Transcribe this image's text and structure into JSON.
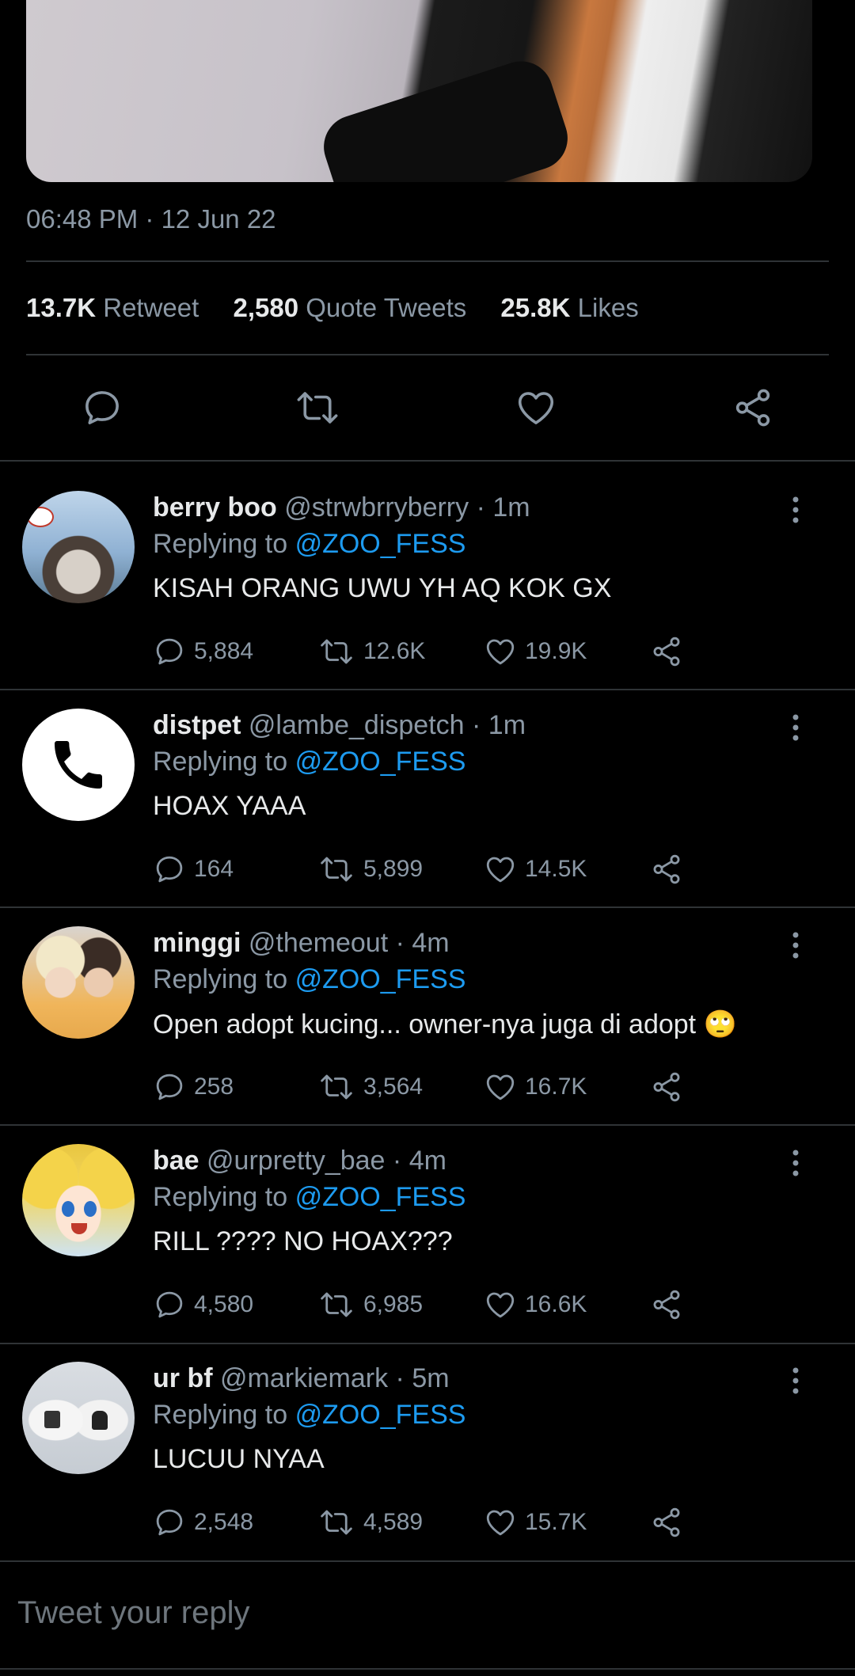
{
  "tweet": {
    "timestamp": "06:48 PM · 12 Jun 22",
    "stats": [
      {
        "count": "13.7K",
        "label": "Retweet"
      },
      {
        "count": "2,580",
        "label": "Quote Tweets"
      },
      {
        "count": "25.8K",
        "label": "Likes"
      }
    ],
    "actions": [
      "reply-icon",
      "retweet-icon",
      "like-icon",
      "share-icon"
    ]
  },
  "replies": [
    {
      "name": "berry boo",
      "handle": "@strwbrryberry",
      "time": "· 1m",
      "replying_label": "Replying to",
      "replying_to": "@ZOO_FESS",
      "text": "KISAH ORANG UWU YH AQ KOK GX",
      "replies": "5,884",
      "retweets": "12.6K",
      "likes": "19.9K"
    },
    {
      "name": "distpet",
      "handle": "@lambe_dispetch",
      "time": "· 1m",
      "replying_label": "Replying to",
      "replying_to": "@ZOO_FESS",
      "text": "HOAX YAAA",
      "replies": "164",
      "retweets": "5,899",
      "likes": "14.5K"
    },
    {
      "name": "minggi",
      "handle": "@themeout",
      "time": "· 4m",
      "replying_label": "Replying to",
      "replying_to": "@ZOO_FESS",
      "text": "Open adopt kucing... owner-nya juga di adopt 🙄",
      "replies": "258",
      "retweets": "3,564",
      "likes": "16.7K"
    },
    {
      "name": "bae",
      "handle": "@urpretty_bae",
      "time": "· 4m",
      "replying_label": "Replying to",
      "replying_to": "@ZOO_FESS",
      "text": "RILL ???? NO HOAX???",
      "replies": "4,580",
      "retweets": "6,985",
      "likes": "16.6K"
    },
    {
      "name": "ur bf",
      "handle": "@markiemark",
      "time": "· 5m",
      "replying_label": "Replying to",
      "replying_to": "@ZOO_FESS",
      "text": "LUCUU NYAA",
      "replies": "2,548",
      "retweets": "4,589",
      "likes": "15.7K"
    }
  ],
  "composer": {
    "placeholder": "Tweet your reply"
  },
  "colors": {
    "background": "#000000",
    "text": "#e7e9ea",
    "secondary": "#8b98a5",
    "link": "#1d9bf0",
    "divider": "#2f3336"
  }
}
